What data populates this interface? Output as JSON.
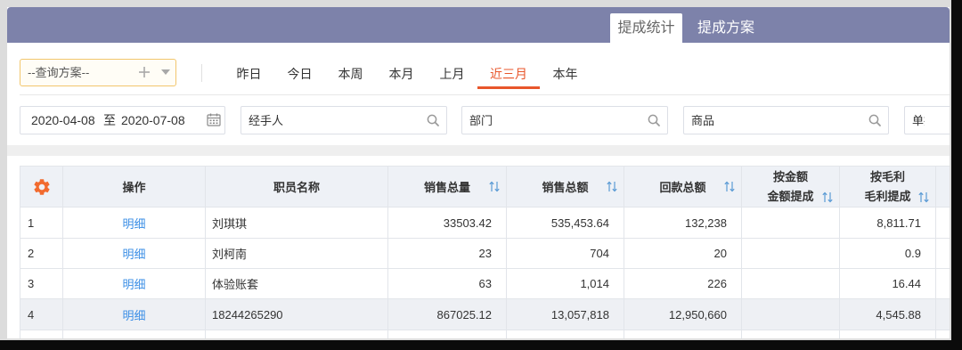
{
  "colors": {
    "topbar_bg": "#7d82aa",
    "accent": "#e8562b",
    "link": "#3a8ee6",
    "sort_icon": "#5b9bd5",
    "gear_icon": "#f26b2f",
    "header_row_bg": "#eef1f6",
    "highlight_row_bg": "#eef0f4"
  },
  "header": {
    "tabs": [
      {
        "label": "提成统计",
        "active": true
      },
      {
        "label": "提成方案",
        "active": false
      }
    ]
  },
  "filters": {
    "scheme_select": {
      "value": "--查询方案--",
      "add_icon": "plus-icon",
      "dropdown_icon": "caret-down-icon"
    },
    "date_tabs": [
      {
        "label": "昨日",
        "active": false
      },
      {
        "label": "今日",
        "active": false
      },
      {
        "label": "本周",
        "active": false
      },
      {
        "label": "本月",
        "active": false
      },
      {
        "label": "上月",
        "active": false
      },
      {
        "label": "近三月",
        "active": true
      },
      {
        "label": "本年",
        "active": false
      }
    ],
    "date_range": {
      "start": "2020-04-08",
      "separator": "至",
      "end": "2020-07-08",
      "icon": "calendar-icon"
    },
    "handler": {
      "placeholder": "经手人",
      "icon": "search-icon"
    },
    "department": {
      "placeholder": "部门",
      "icon": "search-icon"
    },
    "product": {
      "placeholder": "商品",
      "icon": "search-icon"
    },
    "document_type": {
      "placeholder": "单据类"
    }
  },
  "table": {
    "settings_icon": "gear-icon",
    "sort_icon": "sort-icon",
    "columns": {
      "action": "操作",
      "employee_name": "职员名称",
      "sales_quantity": "销售总量",
      "sales_amount": "销售总额",
      "payment_amount": "回款总额",
      "amount_group": "按金额",
      "amount_commission": "金额提成",
      "profit_group": "按毛利",
      "profit_commission": "毛利提成"
    },
    "rows": [
      {
        "index": "1",
        "action": "明细",
        "employee_name": "刘琪琪",
        "sales_quantity": "33503.42",
        "sales_amount": "535,453.64",
        "payment_amount": "132,238",
        "amount_commission": "",
        "profit_commission": "8,811.71",
        "highlighted": false
      },
      {
        "index": "2",
        "action": "明细",
        "employee_name": "刘柯南",
        "sales_quantity": "23",
        "sales_amount": "704",
        "payment_amount": "20",
        "amount_commission": "",
        "profit_commission": "0.9",
        "highlighted": false
      },
      {
        "index": "3",
        "action": "明细",
        "employee_name": "体验账套",
        "sales_quantity": "63",
        "sales_amount": "1,014",
        "payment_amount": "226",
        "amount_commission": "",
        "profit_commission": "16.44",
        "highlighted": false
      },
      {
        "index": "4",
        "action": "明细",
        "employee_name": "18244265290",
        "sales_quantity": "867025.12",
        "sales_amount": "13,057,818",
        "payment_amount": "12,950,660",
        "amount_commission": "",
        "profit_commission": "4,545.88",
        "highlighted": true
      }
    ]
  }
}
